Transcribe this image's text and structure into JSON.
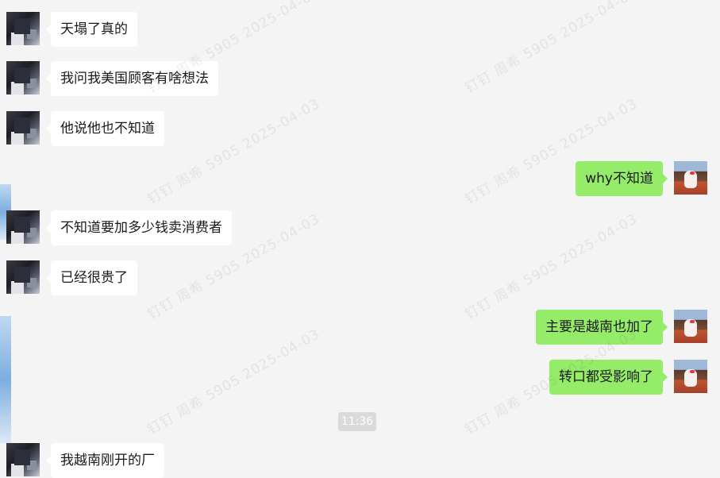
{
  "watermark_text": "钉钉 周希 5905 2025-04-03",
  "colors": {
    "background": "#f4f4f4",
    "bubble_incoming": "#ffffff",
    "bubble_outgoing": "#95ec69",
    "time_badge": "#dadada"
  },
  "messages": [
    {
      "direction": "incoming",
      "text": "天塌了真的"
    },
    {
      "direction": "incoming",
      "text": "我问我美国顾客有啥想法"
    },
    {
      "direction": "incoming",
      "text": "他说他也不知道"
    },
    {
      "direction": "outgoing",
      "text": "why不知道"
    },
    {
      "direction": "incoming",
      "text": "不知道要加多少钱卖消费者"
    },
    {
      "direction": "incoming",
      "text": "已经很贵了"
    },
    {
      "direction": "outgoing",
      "text": "主要是越南也加了"
    },
    {
      "direction": "outgoing",
      "text": "转口都受影响了"
    },
    {
      "direction": "incoming",
      "text": "我越南刚开的厂"
    }
  ],
  "time_divider": "11:36"
}
